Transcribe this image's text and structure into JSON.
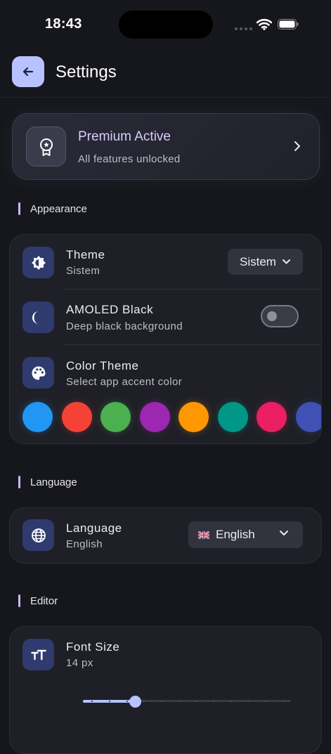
{
  "status_bar": {
    "time": "18:43"
  },
  "header": {
    "title": "Settings"
  },
  "premium": {
    "title": "Premium Active",
    "subtitle": "All features unlocked"
  },
  "sections": {
    "appearance": "Appearance",
    "language": "Language",
    "editor": "Editor"
  },
  "appearance": {
    "theme": {
      "title": "Theme",
      "subtitle": "Sistem",
      "selected": "Sistem"
    },
    "amoled": {
      "title": "AMOLED Black",
      "subtitle": "Deep black background",
      "enabled": false
    },
    "color_theme": {
      "title": "Color Theme",
      "subtitle": "Select app accent color",
      "swatches": [
        "#2196f3",
        "#f44336",
        "#4caf50",
        "#9c27b0",
        "#ff9800",
        "#009688",
        "#e91e63",
        "#3f51b5"
      ]
    }
  },
  "language": {
    "title": "Language",
    "subtitle": "English",
    "selected": "English"
  },
  "editor": {
    "font_size": {
      "title": "Font Size",
      "subtitle": "14 px",
      "value": 14,
      "min": 8,
      "max": 32
    }
  },
  "colors": {
    "accent": "#b8c2ff",
    "icon_bg": "#2f3b6e",
    "background": "#16171c"
  },
  "icons": {
    "back": "arrow-left-icon",
    "premium": "award-badge-icon",
    "theme": "brightness-icon",
    "amoled": "moon-icon",
    "color_theme": "palette-icon",
    "language": "globe-icon",
    "font_size": "text-size-icon"
  }
}
